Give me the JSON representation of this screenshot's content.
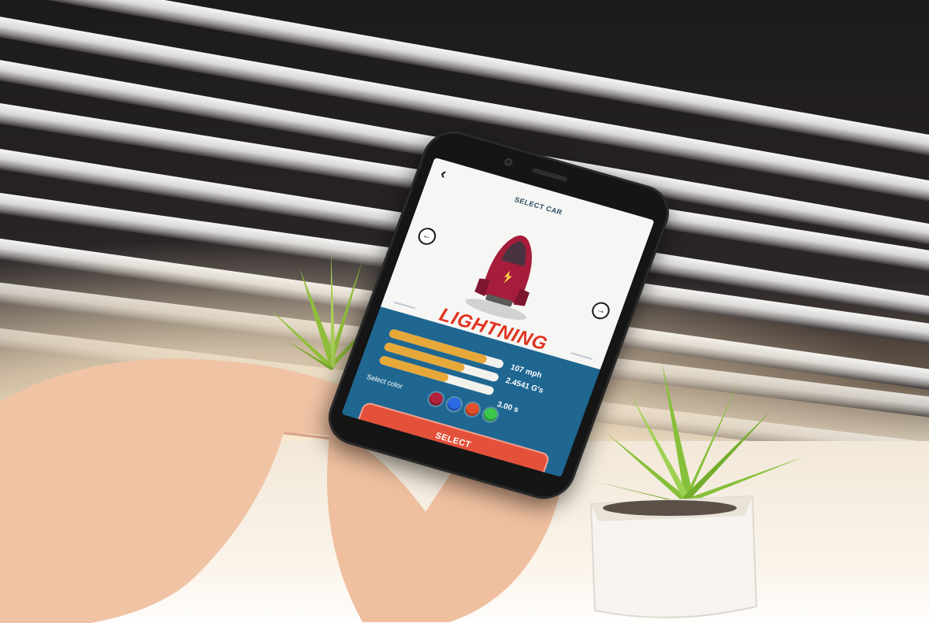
{
  "app": {
    "screen_title": "SELECT CAR",
    "back_label": "‹",
    "prev_arrow": "←",
    "next_arrow": "→",
    "car_name": "LIGHTNING",
    "stats": [
      {
        "value_label": "107 mph",
        "fill": 0.85
      },
      {
        "value_label": "2.4541 G's",
        "fill": 0.7
      },
      {
        "value_label": "3.00 s",
        "fill": 0.6
      }
    ],
    "color_label": "Select color",
    "color_options": [
      {
        "name": "crimson",
        "hex": "#b3213b"
      },
      {
        "name": "blue",
        "hex": "#2d6ae6"
      },
      {
        "name": "orange-red",
        "hex": "#e2502b"
      },
      {
        "name": "green",
        "hex": "#3cc64b"
      }
    ],
    "select_button_label": "SELECT",
    "accent_color": "#e0341f",
    "panel_color": "#1f6791"
  }
}
